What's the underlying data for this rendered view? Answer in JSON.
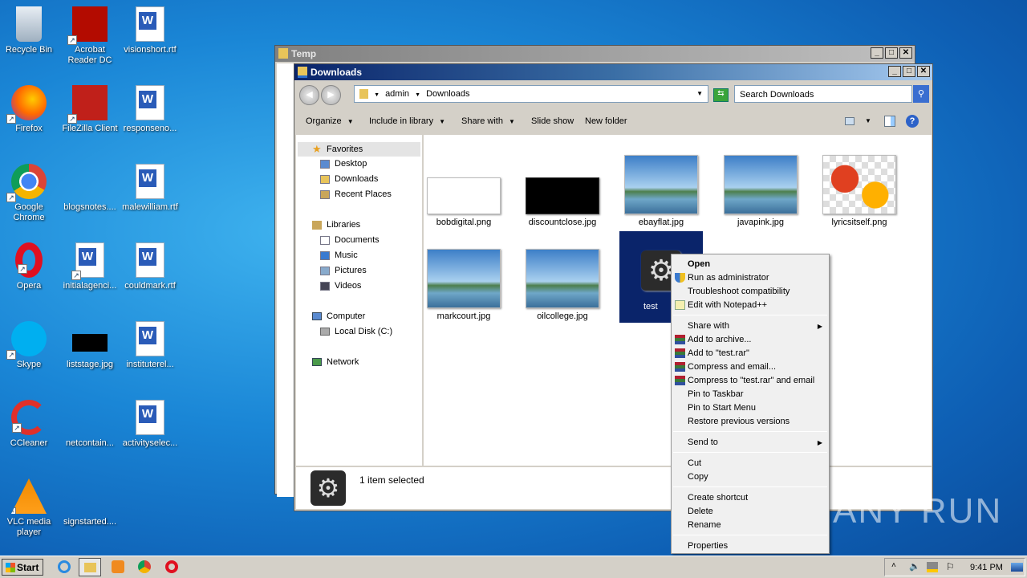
{
  "desktop": {
    "icons": [
      {
        "label": "Recycle Bin",
        "icon": "recycle-bin-icon",
        "col": 0,
        "row": 0
      },
      {
        "label": "Firefox",
        "icon": "firefox-icon",
        "col": 0,
        "row": 1
      },
      {
        "label": "Google Chrome",
        "icon": "chrome-icon",
        "col": 0,
        "row": 2
      },
      {
        "label": "Opera",
        "icon": "opera-icon",
        "col": 0,
        "row": 3
      },
      {
        "label": "Skype",
        "icon": "skype-icon",
        "col": 0,
        "row": 4
      },
      {
        "label": "CCleaner",
        "icon": "ccleaner-icon",
        "col": 0,
        "row": 5
      },
      {
        "label": "VLC media player",
        "icon": "vlc-icon",
        "col": 0,
        "row": 6
      },
      {
        "label": "Acrobat Reader DC",
        "icon": "acrobat-icon",
        "col": 1,
        "row": 0
      },
      {
        "label": "FileZilla Client",
        "icon": "filezilla-icon",
        "col": 1,
        "row": 1
      },
      {
        "label": "blogsnotes....",
        "icon": "blank-file-icon",
        "col": 1,
        "row": 2
      },
      {
        "label": "initialagenci...",
        "icon": "word-doc-icon",
        "col": 1,
        "row": 3
      },
      {
        "label": "liststage.jpg",
        "icon": "image-file-icon",
        "col": 1,
        "row": 4
      },
      {
        "label": "netcontain...",
        "icon": "blank-file-icon",
        "col": 1,
        "row": 5
      },
      {
        "label": "signstarted....",
        "icon": "blank-file-icon",
        "col": 1,
        "row": 6
      },
      {
        "label": "visionshort.rtf",
        "icon": "word-doc-icon",
        "col": 2,
        "row": 0
      },
      {
        "label": "responseno...",
        "icon": "word-doc-icon",
        "col": 2,
        "row": 1
      },
      {
        "label": "malewilliam.rtf",
        "icon": "word-doc-icon",
        "col": 2,
        "row": 2
      },
      {
        "label": "couldmark.rtf",
        "icon": "word-doc-icon",
        "col": 2,
        "row": 3
      },
      {
        "label": "instituterel...",
        "icon": "word-doc-icon",
        "col": 2,
        "row": 4
      },
      {
        "label": "activityselec...",
        "icon": "word-doc-icon",
        "col": 2,
        "row": 5
      }
    ]
  },
  "temp_window": {
    "title": "Temp"
  },
  "explorer": {
    "title": "Downloads",
    "breadcrumb": [
      "admin",
      "Downloads"
    ],
    "search_placeholder": "Search Downloads",
    "toolbar": [
      "Organize",
      "Include in library",
      "Share with",
      "Slide show",
      "New folder"
    ],
    "nav": {
      "favorites": "Favorites",
      "fav_items": [
        "Desktop",
        "Downloads",
        "Recent Places"
      ],
      "libraries": "Libraries",
      "lib_items": [
        "Documents",
        "Music",
        "Pictures",
        "Videos"
      ],
      "computer": "Computer",
      "computer_items": [
        "Local Disk (C:)"
      ],
      "network": "Network"
    },
    "files": [
      {
        "name": "bobdigital.png",
        "kind": "white"
      },
      {
        "name": "discountclose.jpg",
        "kind": "black"
      },
      {
        "name": "ebayflat.jpg",
        "kind": "sky"
      },
      {
        "name": "javapink.jpg",
        "kind": "sky"
      },
      {
        "name": "lyricsitself.png",
        "kind": "flower"
      },
      {
        "name": "markcourt.jpg",
        "kind": "sky"
      },
      {
        "name": "oilcollege.jpg",
        "kind": "sky"
      },
      {
        "name": "test",
        "kind": "exe",
        "selected": true
      }
    ],
    "status": "1 item selected"
  },
  "context_menu": {
    "items": [
      {
        "label": "Open",
        "bold": true,
        "icon": null
      },
      {
        "label": "Run as administrator",
        "icon": "uac-shield-icon"
      },
      {
        "label": "Troubleshoot compatibility"
      },
      {
        "label": "Edit with Notepad++",
        "icon": "notepadpp-icon"
      },
      {
        "sep": true
      },
      {
        "label": "Share with",
        "submenu": true
      },
      {
        "label": "Add to archive...",
        "icon": "winrar-icon"
      },
      {
        "label": "Add to \"test.rar\"",
        "icon": "winrar-icon"
      },
      {
        "label": "Compress and email...",
        "icon": "winrar-icon"
      },
      {
        "label": "Compress to \"test.rar\" and email",
        "icon": "winrar-icon"
      },
      {
        "label": "Pin to Taskbar"
      },
      {
        "label": "Pin to Start Menu"
      },
      {
        "label": "Restore previous versions"
      },
      {
        "sep": true
      },
      {
        "label": "Send to",
        "submenu": true
      },
      {
        "sep": true
      },
      {
        "label": "Cut"
      },
      {
        "label": "Copy"
      },
      {
        "sep": true
      },
      {
        "label": "Create shortcut"
      },
      {
        "label": "Delete"
      },
      {
        "label": "Rename"
      },
      {
        "sep": true
      },
      {
        "label": "Properties"
      }
    ]
  },
  "taskbar": {
    "start": "Start",
    "clock": "9:41 PM"
  },
  "watermark": "ANY RUN"
}
